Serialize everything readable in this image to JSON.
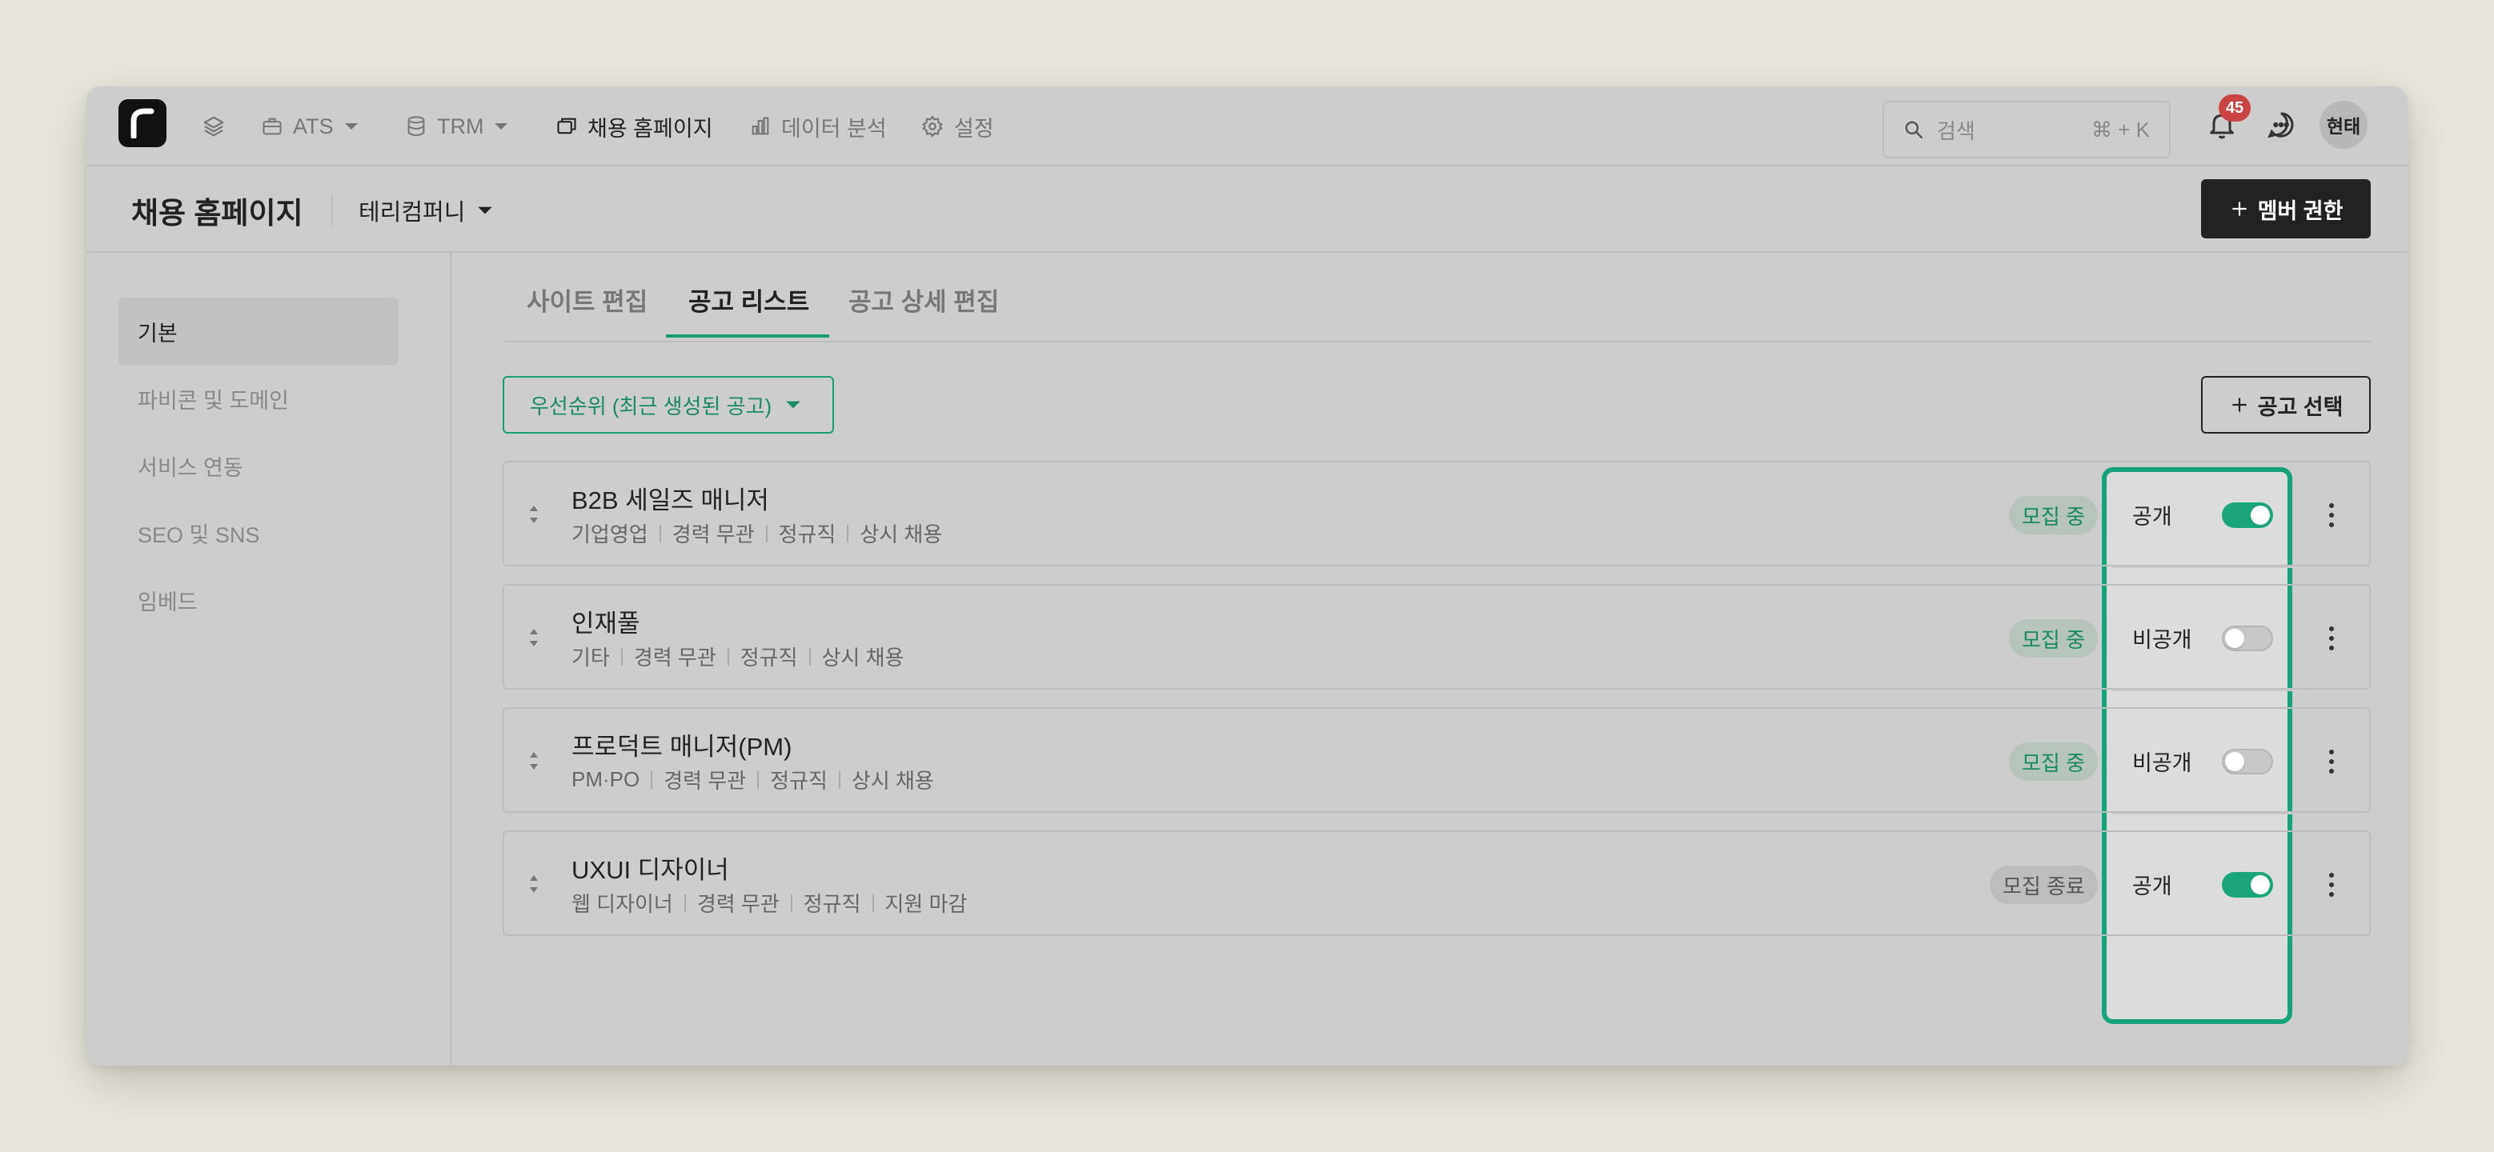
{
  "nav": {
    "items": [
      {
        "label": "",
        "icon": "layers-icon"
      },
      {
        "label": "ATS",
        "icon": "briefcase-icon",
        "dropdown": true
      },
      {
        "label": "TRM",
        "icon": "database-icon",
        "dropdown": true
      },
      {
        "label": "채용 홈페이지",
        "icon": "window-icon",
        "active": true
      },
      {
        "label": "데이터 분석",
        "icon": "bar-chart-icon"
      },
      {
        "label": "설정",
        "icon": "gear-icon"
      }
    ],
    "search_placeholder": "검색",
    "search_shortcut": "⌘ + K",
    "notification_count": "45",
    "user_name": "현태"
  },
  "header": {
    "title": "채용 홈페이지",
    "company": "테리컴퍼니",
    "member_button": "멤버 권한"
  },
  "sidebar": {
    "items": [
      {
        "label": "기본",
        "active": true
      },
      {
        "label": "파비콘 및 도메인"
      },
      {
        "label": "서비스 연동"
      },
      {
        "label": "SEO 및 SNS"
      },
      {
        "label": "임베드"
      }
    ]
  },
  "tabs": [
    {
      "label": "사이트 편집"
    },
    {
      "label": "공고 리스트",
      "active": true
    },
    {
      "label": "공고 상세 편집"
    }
  ],
  "toolbar": {
    "sort_label": "우선순위 (최근 생성된 공고)",
    "select_label": "공고 선택"
  },
  "jobs": [
    {
      "title": "B2B 세일즈 매니저",
      "meta": [
        "기업영업",
        "경력 무관",
        "정규직",
        "상시 채용"
      ],
      "status": "모집 중",
      "status_type": "open",
      "visibility": "공개",
      "public": true
    },
    {
      "title": "인재풀",
      "meta": [
        "기타",
        "경력 무관",
        "정규직",
        "상시 채용"
      ],
      "status": "모집 중",
      "status_type": "open",
      "visibility": "비공개",
      "public": false
    },
    {
      "title": "프로덕트 매니저(PM)",
      "meta": [
        "PM·PO",
        "경력 무관",
        "정규직",
        "상시 채용"
      ],
      "status": "모집 중",
      "status_type": "open",
      "visibility": "비공개",
      "public": false
    },
    {
      "title": "UXUI 디자이너",
      "meta": [
        "웹 디자이너",
        "경력 무관",
        "정규직",
        "지원 마감"
      ],
      "status": "모집 종료",
      "status_type": "closed",
      "visibility": "공개",
      "public": true
    }
  ],
  "colors": {
    "accent": "#14a37b",
    "overlay": "#cdcdcd",
    "badge": "#c94444"
  }
}
